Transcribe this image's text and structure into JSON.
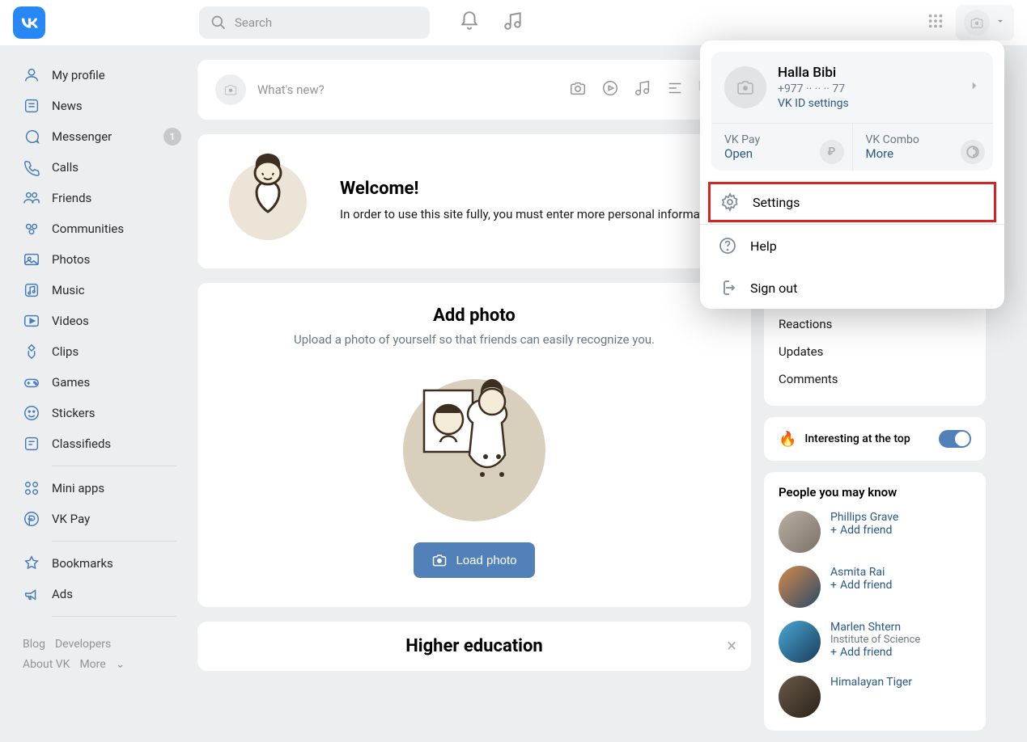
{
  "header": {
    "search_placeholder": "Search"
  },
  "sidebar": {
    "items": [
      {
        "label": "My profile"
      },
      {
        "label": "News"
      },
      {
        "label": "Messenger",
        "badge": "1"
      },
      {
        "label": "Calls"
      },
      {
        "label": "Friends"
      },
      {
        "label": "Communities"
      },
      {
        "label": "Photos"
      },
      {
        "label": "Music"
      },
      {
        "label": "Videos"
      },
      {
        "label": "Clips"
      },
      {
        "label": "Games"
      },
      {
        "label": "Stickers"
      },
      {
        "label": "Classifieds"
      }
    ],
    "extra": [
      {
        "label": "Mini apps"
      },
      {
        "label": "VK Pay"
      }
    ],
    "bottom": [
      {
        "label": "Bookmarks"
      },
      {
        "label": "Ads"
      }
    ]
  },
  "footer": {
    "blog": "Blog",
    "developers": "Developers",
    "about": "About VK",
    "more": "More"
  },
  "newpost": {
    "placeholder": "What's new?"
  },
  "welcome": {
    "title": "Welcome!",
    "body": "In order to use this site fully, you must enter more personal information."
  },
  "addphoto": {
    "title": "Add photo",
    "subtitle": "Upload a photo of yourself so that friends can easily recognize you.",
    "button": "Load photo"
  },
  "education": {
    "title": "Higher education"
  },
  "right": {
    "tabs": [
      "Reactions",
      "Updates",
      "Comments"
    ],
    "interesting": "Interesting at the top",
    "pymk_title": "People you may know",
    "add_friend": "Add friend",
    "people": [
      {
        "name": "Phillips Grave",
        "sub": ""
      },
      {
        "name": "Asmita Rai",
        "sub": ""
      },
      {
        "name": "Marlen Shtern",
        "sub": "Institute of Science"
      },
      {
        "name": "Himalayan Tiger",
        "sub": ""
      }
    ]
  },
  "dropdown": {
    "name": "Halla Bibi",
    "phone": "+977 ·· ·· ·· 77",
    "vkid": "VK ID settings",
    "pay_t": "VK Pay",
    "pay_a": "Open",
    "combo_t": "VK Combo",
    "combo_a": "More",
    "settings": "Settings",
    "help": "Help",
    "signout": "Sign out"
  }
}
